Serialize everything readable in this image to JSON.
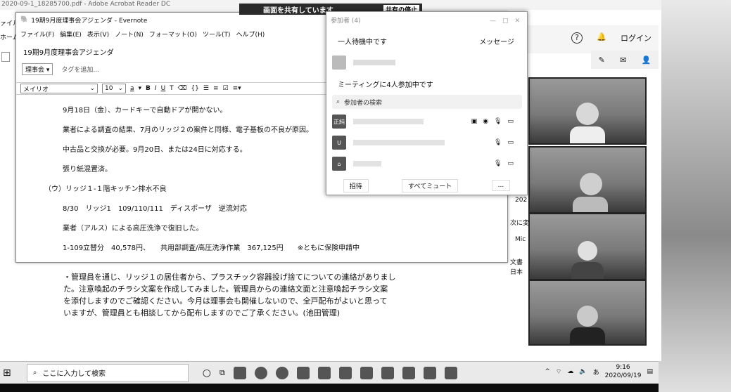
{
  "top": {
    "window_title": "2020-09-1_18285700.pdf - Adobe Acrobat Reader DC",
    "share_status": "画面を共有しています",
    "stop_share": "共有の停止"
  },
  "acrobat": {
    "menu_partial": "ァイル",
    "home_partial": "ホーム"
  },
  "evernote": {
    "title": "19期9月度理事会アジェンダ - Evernote",
    "menu": [
      "ファイル(F)",
      "編集(E)",
      "表示(V)",
      "ノート(N)",
      "フォーマット(O)",
      "ツール(T)",
      "ヘルプ(H)"
    ],
    "note_title": "19期9月度理事会アジェンダ",
    "notebook": "理事会",
    "tag_placeholder": "タグを追加...",
    "font": "メイリオ",
    "font_size": "10",
    "body_lines": [
      "9月18日（金）、カードキーで自動ドアが開かない。",
      "業者による調査の結果、7月のリッジ２の案件と同様、電子基板の不良が原因。",
      "中古品と交換が必要。9月20日、または24日に対応する。",
      "張り紙混置済。",
      "（ウ）リッジ１-１階キッチン排水不良",
      "8/30　リッジ1　109/110/111　ディスポーザ　逆流対応",
      "業者（アルス）による高圧洗浄で復旧した。",
      "1-109立替分　40,578円、　　共用部調査/高圧洗浄作業　367,125円　　※ともに保険申請中"
    ]
  },
  "pdf_text": [
    "・管理員を通じ、リッジ１の居住者から、プラスチック容器投げ捨てについての連絡がありまし",
    "た。注意喚起のチラシ文案を作成してみました。管理員からの連絡文面と注意喚起チラシ文案",
    "を添付しますのでご確認ください。今月は理事会も開催しないので、全戸配布がよいと思って",
    "いますが、管理員とも相談してから配布しますのでご了承ください。(池田管理)"
  ],
  "zoom": {
    "header": "参加者 (4)",
    "waiting_label": "一人待機中です",
    "message_button": "メッセージ",
    "in_meeting_label": "ミーティングに4人参加中です",
    "search_placeholder": "参加者の検索",
    "participants": [
      {
        "avatar": "正純"
      },
      {
        "avatar": "U"
      },
      {
        "avatar": "⌂"
      }
    ],
    "invite_button": "招待",
    "mute_all_button": "すべてミュート",
    "more_button": "..."
  },
  "right": {
    "login_label": "ログイン",
    "side_texts": [
      "202",
      "次に変",
      "Mic",
      "文書",
      "日本"
    ]
  },
  "taskbar": {
    "search_placeholder": "ここに入力して検索",
    "time": "9:16",
    "date": "2020/09/19",
    "ime": "あ"
  }
}
